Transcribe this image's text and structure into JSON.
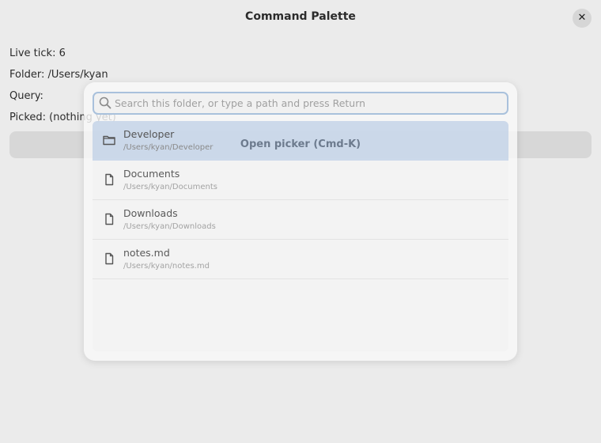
{
  "window": {
    "title": "Command Palette",
    "close_label": "✕"
  },
  "info": {
    "live_tick": "Live tick: 6",
    "folder": "Folder: /Users/kyan",
    "query": "Query:",
    "picked": "Picked: (nothing yet)"
  },
  "actions": {
    "open_picker_label": "Open picker (Cmd-K)"
  },
  "search": {
    "placeholder": "Search this folder, or type a path and press Return",
    "value": ""
  },
  "results": [
    {
      "name": "Developer",
      "path": "/Users/kyan/Developer",
      "icon": "folder-icon",
      "selected": true
    },
    {
      "name": "Documents",
      "path": "/Users/kyan/Documents",
      "icon": "file-icon",
      "selected": false
    },
    {
      "name": "Downloads",
      "path": "/Users/kyan/Downloads",
      "icon": "file-icon",
      "selected": false
    },
    {
      "name": "notes.md",
      "path": "/Users/kyan/notes.md",
      "icon": "file-icon",
      "selected": false
    }
  ]
}
